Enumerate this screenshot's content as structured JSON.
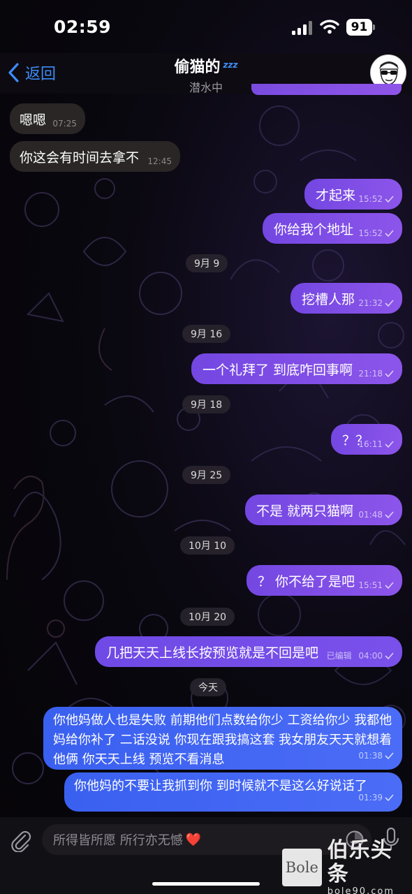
{
  "status_bar": {
    "time": "02:59",
    "battery": "91"
  },
  "header": {
    "back_label": "返回",
    "title": "偷猫的",
    "title_badge": "zzz",
    "status": "潜水中"
  },
  "messages": [
    {
      "side": "in",
      "text": "嗯嗯",
      "time": "07:25"
    },
    {
      "side": "in",
      "text": "你这会有时间去拿不",
      "time": "12:45"
    },
    {
      "side": "out",
      "text": "才起来",
      "time": "15:52"
    },
    {
      "side": "out",
      "text": "你给我个地址",
      "time": "15:52"
    },
    {
      "side": "out",
      "text": "挖槽人那",
      "time": "21:32"
    },
    {
      "side": "out",
      "text": "一个礼拜了 到底咋回事啊",
      "time": "21:18"
    },
    {
      "side": "out",
      "text": "？？",
      "time": "16:11"
    },
    {
      "side": "out",
      "text": "不是 就两只猫啊",
      "time": "01:48"
    },
    {
      "side": "out",
      "text": "？ 你不给了是吧",
      "time": "15:51"
    },
    {
      "side": "out",
      "text": "几把天天上线长按预览就是不回是吧",
      "time": "04:00",
      "edited": "已编辑"
    },
    {
      "side": "out",
      "text": "你他妈做人也是失败 前期他们点数给你少 工资给你少 我都他妈给你补了 二话没说 你现在跟我搞这套 我女朋友天天就想着他俩 你天天上线 预览不看消息",
      "time": "01:38"
    },
    {
      "side": "out",
      "text": "你他妈的不要让我抓到你 到时候就不是这么好说话了",
      "time": "01:39"
    }
  ],
  "dates": [
    "9月 9",
    "9月 16",
    "9月 18",
    "9月 25",
    "10月 10",
    "10月 20",
    "今天"
  ],
  "input": {
    "text": "所得皆所愿 所行亦无憾",
    "emoji": "❤️"
  },
  "watermark": {
    "logo": "Bole",
    "name": "伯乐头条",
    "url": "bole90.com"
  },
  "colors": {
    "accent": "#3d8cf7",
    "outgoing_bubble": "#8050e6",
    "incoming_bubble": "#2a2626",
    "recent_bubble": "#4466f2"
  }
}
